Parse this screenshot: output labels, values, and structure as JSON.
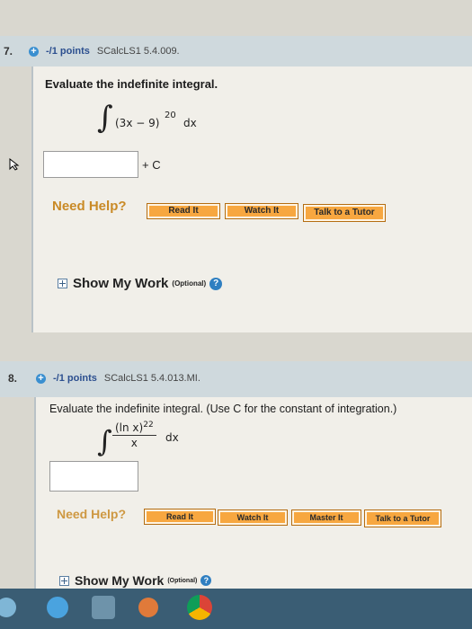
{
  "q7": {
    "number": "7.",
    "points": "-/1 points",
    "code": "SCalcLS1 5.4.009.",
    "prompt": "Evaluate the indefinite integral.",
    "integrand_base": "(3x − 9)",
    "exponent": "20",
    "differential": "dx",
    "plus_c": "+ C",
    "need_help": "Need Help?",
    "buttons": [
      "Read It",
      "Watch It",
      "Talk to a Tutor"
    ],
    "show_work": "Show My Work",
    "optional": "(Optional)"
  },
  "q8": {
    "number": "8.",
    "points": "-/1 points",
    "code": "SCalcLS1 5.4.013.MI.",
    "prompt": "Evaluate the indefinite integral. (Use C for the constant of integration.)",
    "numerator_base": "(ln x)",
    "exponent": "22",
    "denominator": "x",
    "differential": "dx",
    "need_help": "Need Help?",
    "buttons": [
      "Read It",
      "Watch It",
      "Master It",
      "Talk to a Tutor"
    ],
    "show_work": "Show My Work",
    "optional": "(Optional)"
  },
  "colors": {
    "button_orange": "#f7a740",
    "need_help": "#c98a26",
    "points_blue": "#2c4f8f",
    "help_blue": "#2f7fc1"
  },
  "icons": [
    "plus-circle-icon",
    "expand-square-icon",
    "question-circle-icon",
    "cursor-icon"
  ]
}
